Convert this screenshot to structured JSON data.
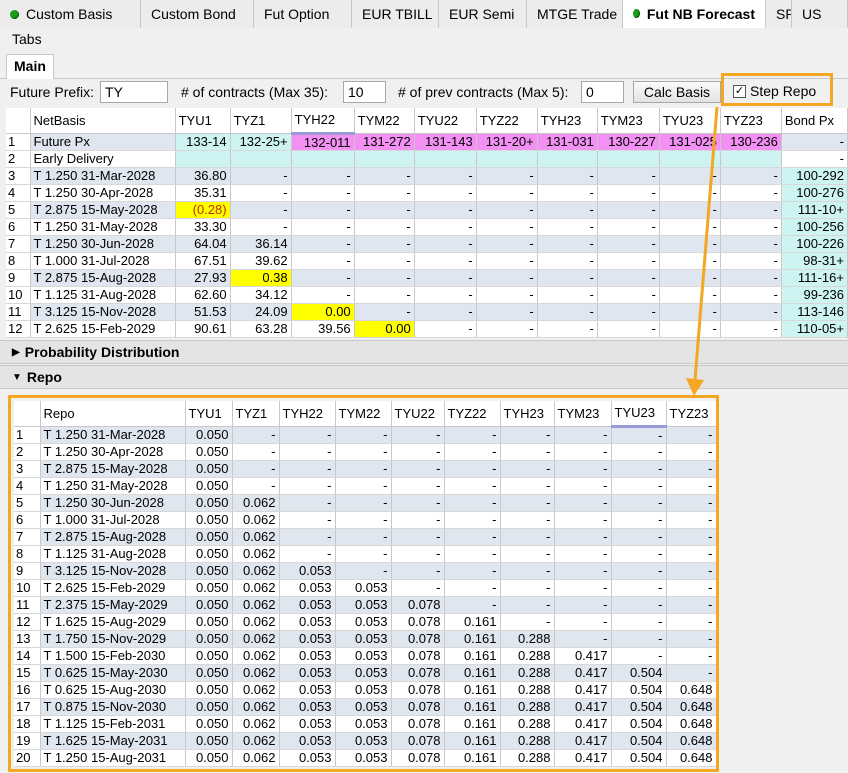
{
  "top_tabs": [
    {
      "label": "Custom Basis",
      "dot": true
    },
    {
      "label": "Custom Bond",
      "dot": false
    },
    {
      "label": "Fut Option",
      "dot": false
    },
    {
      "label": "EUR TBILL",
      "dot": false
    },
    {
      "label": "EUR Semi",
      "dot": false
    },
    {
      "label": "MTGE Trade",
      "dot": false
    },
    {
      "label": "Fut NB Forecast",
      "dot": true,
      "active": true
    },
    {
      "label": "SP",
      "dot": false
    },
    {
      "label": "US",
      "dot": false
    }
  ],
  "tabs_label": "Tabs",
  "sub_tab": "Main",
  "toolbar": {
    "prefix_label": "Future Prefix:",
    "prefix_value": "TY",
    "contracts_label": "# of contracts (Max 35):",
    "contracts_value": "10",
    "prev_label": "# of prev contracts (Max 5):",
    "prev_value": "0",
    "calc_label": "Calc Basis",
    "step_repo_label": "Step Repo",
    "step_repo_checked": true
  },
  "netbasis": {
    "columns": [
      "NetBasis",
      "TYU1",
      "TYZ1",
      "TYH22",
      "TYM22",
      "TYU22",
      "TYZ22",
      "TYH23",
      "TYM23",
      "TYU23",
      "TYZ23",
      "Bond Px"
    ],
    "future_px": {
      "num": "1",
      "label": "Future Px",
      "values": [
        "133-14",
        "132-25+",
        "132-011",
        "131-272",
        "131-143",
        "131-20+",
        "131-031",
        "130-227",
        "131-025",
        "130-236",
        "-"
      ]
    },
    "early": {
      "num": "2",
      "label": "Early Delivery",
      "values": [
        "",
        "",
        "",
        "",
        "",
        "",
        "",
        "",
        "",
        "",
        "-"
      ]
    },
    "rows": [
      {
        "num": "3",
        "label": "T 1.250 31-Mar-2028",
        "values": [
          "36.80",
          "-",
          "-",
          "-",
          "-",
          "-",
          "-",
          "-",
          "-",
          "-",
          "100-292"
        ]
      },
      {
        "num": "4",
        "label": "T 1.250 30-Apr-2028",
        "values": [
          "35.31",
          "-",
          "-",
          "-",
          "-",
          "-",
          "-",
          "-",
          "-",
          "-",
          "100-276"
        ]
      },
      {
        "num": "5",
        "label": "T 2.875 15-May-2028",
        "values": [
          "(0.28)",
          "-",
          "-",
          "-",
          "-",
          "-",
          "-",
          "-",
          "-",
          "-",
          "111-10+"
        ]
      },
      {
        "num": "6",
        "label": "T 1.250 31-May-2028",
        "values": [
          "33.30",
          "-",
          "-",
          "-",
          "-",
          "-",
          "-",
          "-",
          "-",
          "-",
          "100-256"
        ]
      },
      {
        "num": "7",
        "label": "T 1.250 30-Jun-2028",
        "values": [
          "64.04",
          "36.14",
          "-",
          "-",
          "-",
          "-",
          "-",
          "-",
          "-",
          "-",
          "100-226"
        ]
      },
      {
        "num": "8",
        "label": "T 1.000 31-Jul-2028",
        "values": [
          "67.51",
          "39.62",
          "-",
          "-",
          "-",
          "-",
          "-",
          "-",
          "-",
          "-",
          "98-31+"
        ]
      },
      {
        "num": "9",
        "label": "T 2.875 15-Aug-2028",
        "values": [
          "27.93",
          "0.38",
          "-",
          "-",
          "-",
          "-",
          "-",
          "-",
          "-",
          "-",
          "111-16+"
        ]
      },
      {
        "num": "10",
        "label": "T 1.125 31-Aug-2028",
        "values": [
          "62.60",
          "34.12",
          "-",
          "-",
          "-",
          "-",
          "-",
          "-",
          "-",
          "-",
          "99-236"
        ]
      },
      {
        "num": "11",
        "label": "T 3.125 15-Nov-2028",
        "values": [
          "51.53",
          "24.09",
          "0.00",
          "-",
          "-",
          "-",
          "-",
          "-",
          "-",
          "-",
          "113-146"
        ]
      },
      {
        "num": "12",
        "label": "T 2.625 15-Feb-2029",
        "values": [
          "90.61",
          "63.28",
          "39.56",
          "0.00",
          "-",
          "-",
          "-",
          "-",
          "-",
          "-",
          "110-05+"
        ]
      }
    ]
  },
  "sections": {
    "probability": "Probability Distribution",
    "repo": "Repo"
  },
  "repo": {
    "columns": [
      "Repo",
      "TYU1",
      "TYZ1",
      "TYH22",
      "TYM22",
      "TYU22",
      "TYZ22",
      "TYH23",
      "TYM23",
      "TYU23",
      "TYZ23"
    ],
    "rows": [
      {
        "num": "1",
        "label": "T 1.250 31-Mar-2028",
        "values": [
          "0.050",
          "-",
          "-",
          "-",
          "-",
          "-",
          "-",
          "-",
          "-",
          "-"
        ]
      },
      {
        "num": "2",
        "label": "T 1.250 30-Apr-2028",
        "values": [
          "0.050",
          "-",
          "-",
          "-",
          "-",
          "-",
          "-",
          "-",
          "-",
          "-"
        ]
      },
      {
        "num": "3",
        "label": "T 2.875 15-May-2028",
        "values": [
          "0.050",
          "-",
          "-",
          "-",
          "-",
          "-",
          "-",
          "-",
          "-",
          "-"
        ]
      },
      {
        "num": "4",
        "label": "T 1.250 31-May-2028",
        "values": [
          "0.050",
          "-",
          "-",
          "-",
          "-",
          "-",
          "-",
          "-",
          "-",
          "-"
        ]
      },
      {
        "num": "5",
        "label": "T 1.250 30-Jun-2028",
        "values": [
          "0.050",
          "0.062",
          "-",
          "-",
          "-",
          "-",
          "-",
          "-",
          "-",
          "-"
        ]
      },
      {
        "num": "6",
        "label": "T 1.000 31-Jul-2028",
        "values": [
          "0.050",
          "0.062",
          "-",
          "-",
          "-",
          "-",
          "-",
          "-",
          "-",
          "-"
        ]
      },
      {
        "num": "7",
        "label": "T 2.875 15-Aug-2028",
        "values": [
          "0.050",
          "0.062",
          "-",
          "-",
          "-",
          "-",
          "-",
          "-",
          "-",
          "-"
        ]
      },
      {
        "num": "8",
        "label": "T 1.125 31-Aug-2028",
        "values": [
          "0.050",
          "0.062",
          "-",
          "-",
          "-",
          "-",
          "-",
          "-",
          "-",
          "-"
        ]
      },
      {
        "num": "9",
        "label": "T 3.125 15-Nov-2028",
        "values": [
          "0.050",
          "0.062",
          "0.053",
          "-",
          "-",
          "-",
          "-",
          "-",
          "-",
          "-"
        ]
      },
      {
        "num": "10",
        "label": "T 2.625 15-Feb-2029",
        "values": [
          "0.050",
          "0.062",
          "0.053",
          "0.053",
          "-",
          "-",
          "-",
          "-",
          "-",
          "-"
        ]
      },
      {
        "num": "11",
        "label": "T 2.375 15-May-2029",
        "values": [
          "0.050",
          "0.062",
          "0.053",
          "0.053",
          "0.078",
          "-",
          "-",
          "-",
          "-",
          "-"
        ]
      },
      {
        "num": "12",
        "label": "T 1.625 15-Aug-2029",
        "values": [
          "0.050",
          "0.062",
          "0.053",
          "0.053",
          "0.078",
          "0.161",
          "-",
          "-",
          "-",
          "-"
        ]
      },
      {
        "num": "13",
        "label": "T 1.750 15-Nov-2029",
        "values": [
          "0.050",
          "0.062",
          "0.053",
          "0.053",
          "0.078",
          "0.161",
          "0.288",
          "-",
          "-",
          "-"
        ]
      },
      {
        "num": "14",
        "label": "T 1.500 15-Feb-2030",
        "values": [
          "0.050",
          "0.062",
          "0.053",
          "0.053",
          "0.078",
          "0.161",
          "0.288",
          "0.417",
          "-",
          "-"
        ]
      },
      {
        "num": "15",
        "label": "T 0.625 15-May-2030",
        "values": [
          "0.050",
          "0.062",
          "0.053",
          "0.053",
          "0.078",
          "0.161",
          "0.288",
          "0.417",
          "0.504",
          "-"
        ]
      },
      {
        "num": "16",
        "label": "T 0.625 15-Aug-2030",
        "values": [
          "0.050",
          "0.062",
          "0.053",
          "0.053",
          "0.078",
          "0.161",
          "0.288",
          "0.417",
          "0.504",
          "0.648"
        ]
      },
      {
        "num": "17",
        "label": "T 0.875 15-Nov-2030",
        "values": [
          "0.050",
          "0.062",
          "0.053",
          "0.053",
          "0.078",
          "0.161",
          "0.288",
          "0.417",
          "0.504",
          "0.648"
        ]
      },
      {
        "num": "18",
        "label": "T 1.125 15-Feb-2031",
        "values": [
          "0.050",
          "0.062",
          "0.053",
          "0.053",
          "0.078",
          "0.161",
          "0.288",
          "0.417",
          "0.504",
          "0.648"
        ]
      },
      {
        "num": "19",
        "label": "T 1.625 15-May-2031",
        "values": [
          "0.050",
          "0.062",
          "0.053",
          "0.053",
          "0.078",
          "0.161",
          "0.288",
          "0.417",
          "0.504",
          "0.648"
        ]
      },
      {
        "num": "20",
        "label": "T 1.250 15-Aug-2031",
        "values": [
          "0.050",
          "0.062",
          "0.053",
          "0.053",
          "0.078",
          "0.161",
          "0.288",
          "0.417",
          "0.504",
          "0.648"
        ]
      }
    ]
  },
  "colors": {
    "highlight_yellow": "#ffff00",
    "future_cyan": "#cdf3f3",
    "future_magenta": "#f390f3",
    "row_stripe": "#dfe6f0",
    "annotation_orange": "#f5a623",
    "tab_dot_green": "#1a9e1a"
  }
}
